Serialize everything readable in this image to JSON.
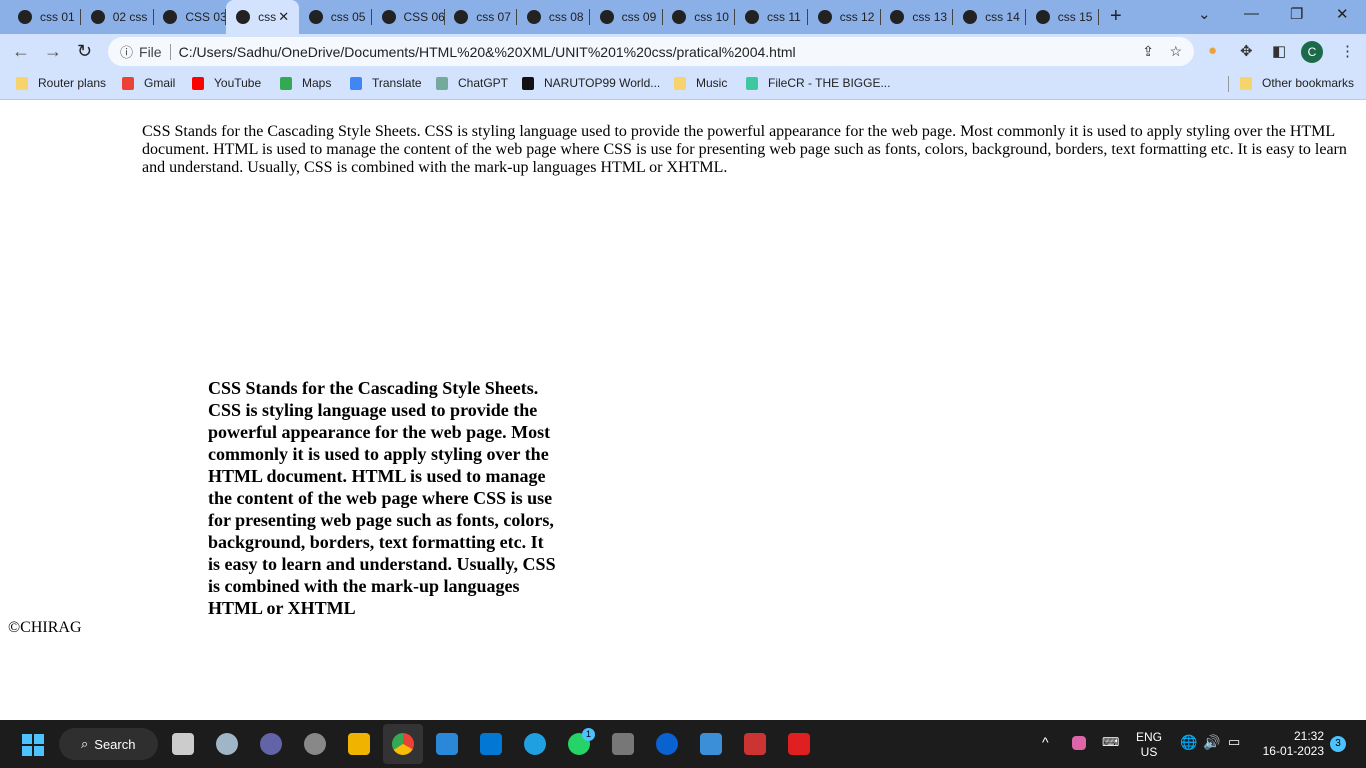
{
  "tabs": [
    "css 01",
    "02 css",
    "CSS 03",
    "css",
    "css 05",
    "CSS 06",
    "css 07",
    "css 08",
    "css 09",
    "css 10",
    "css 11",
    "css 12",
    "css 13",
    "css 14",
    "css 15"
  ],
  "active_tab": 3,
  "address": {
    "scheme_label": "File",
    "url": "C:/Users/Sadhu/OneDrive/Documents/HTML%20&%20XML/UNIT%201%20css/pratical%2004.html"
  },
  "profile_initial": "C",
  "bookmarks": [
    {
      "label": "Router plans",
      "color": "#f6d36b"
    },
    {
      "label": "Gmail",
      "color": "#ea4335"
    },
    {
      "label": "YouTube",
      "color": "#ff0000"
    },
    {
      "label": "Maps",
      "color": "#34a853"
    },
    {
      "label": "Translate",
      "color": "#4285f4"
    },
    {
      "label": "ChatGPT",
      "color": "#74aa9c"
    },
    {
      "label": "NARUTOP99 World...",
      "color": "#111111"
    },
    {
      "label": "Music",
      "color": "#f6d36b"
    },
    {
      "label": "FileCR - THE BIGGE...",
      "color": "#3ec7a0"
    }
  ],
  "other_bookmarks": "Other bookmarks",
  "content": {
    "paragraph1": "CSS Stands for the Cascading Style Sheets. CSS is styling language used to provide the powerful appearance for the web page. Most commonly it is used to apply styling over the HTML document. HTML is used to manage the content of the web page where CSS is use for presenting web page such as fonts, colors, background, borders, text formatting etc. It is easy to learn and understand. Usually, CSS is combined with the mark-up languages HTML or XHTML.",
    "paragraph2": "CSS Stands for the Cascading Style Sheets. CSS is styling language used to provide the powerful appearance for the web page. Most commonly it is used to apply styling over the HTML document. HTML is used to manage the content of the web page where CSS is use for presenting web page such as fonts, colors, background, borders, text formatting etc. It is easy to learn and understand. Usually, CSS is combined with the mark-up languages HTML or XHTML",
    "footer": "©CHIRAG"
  },
  "taskbar": {
    "search_label": "Search",
    "lang1": "ENG",
    "lang2": "US",
    "time": "21:32",
    "date": "16-01-2023",
    "notifications": "3",
    "whatsapp_badge": "1"
  }
}
